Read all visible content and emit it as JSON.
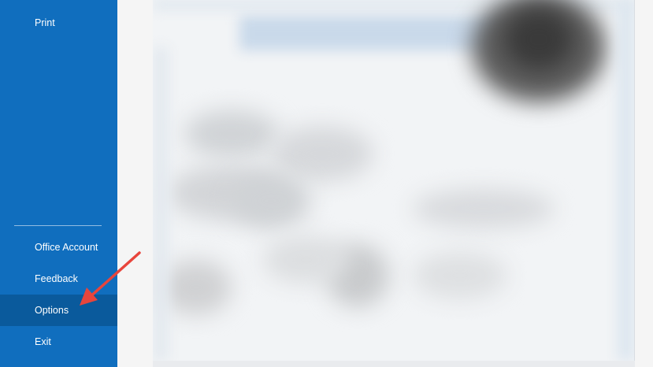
{
  "sidebar": {
    "items": [
      {
        "key": "print",
        "label": "Print"
      },
      {
        "key": "office-account",
        "label": "Office Account"
      },
      {
        "key": "feedback",
        "label": "Feedback"
      },
      {
        "key": "options",
        "label": "Options",
        "selected": true
      },
      {
        "key": "exit",
        "label": "Exit"
      }
    ]
  },
  "colors": {
    "sidebar_bg": "#106ebe",
    "selected_bg": "#0a5a9c",
    "annotation_arrow": "#e8453c"
  },
  "icons": {
    "annotation": "red-arrow-icon"
  }
}
